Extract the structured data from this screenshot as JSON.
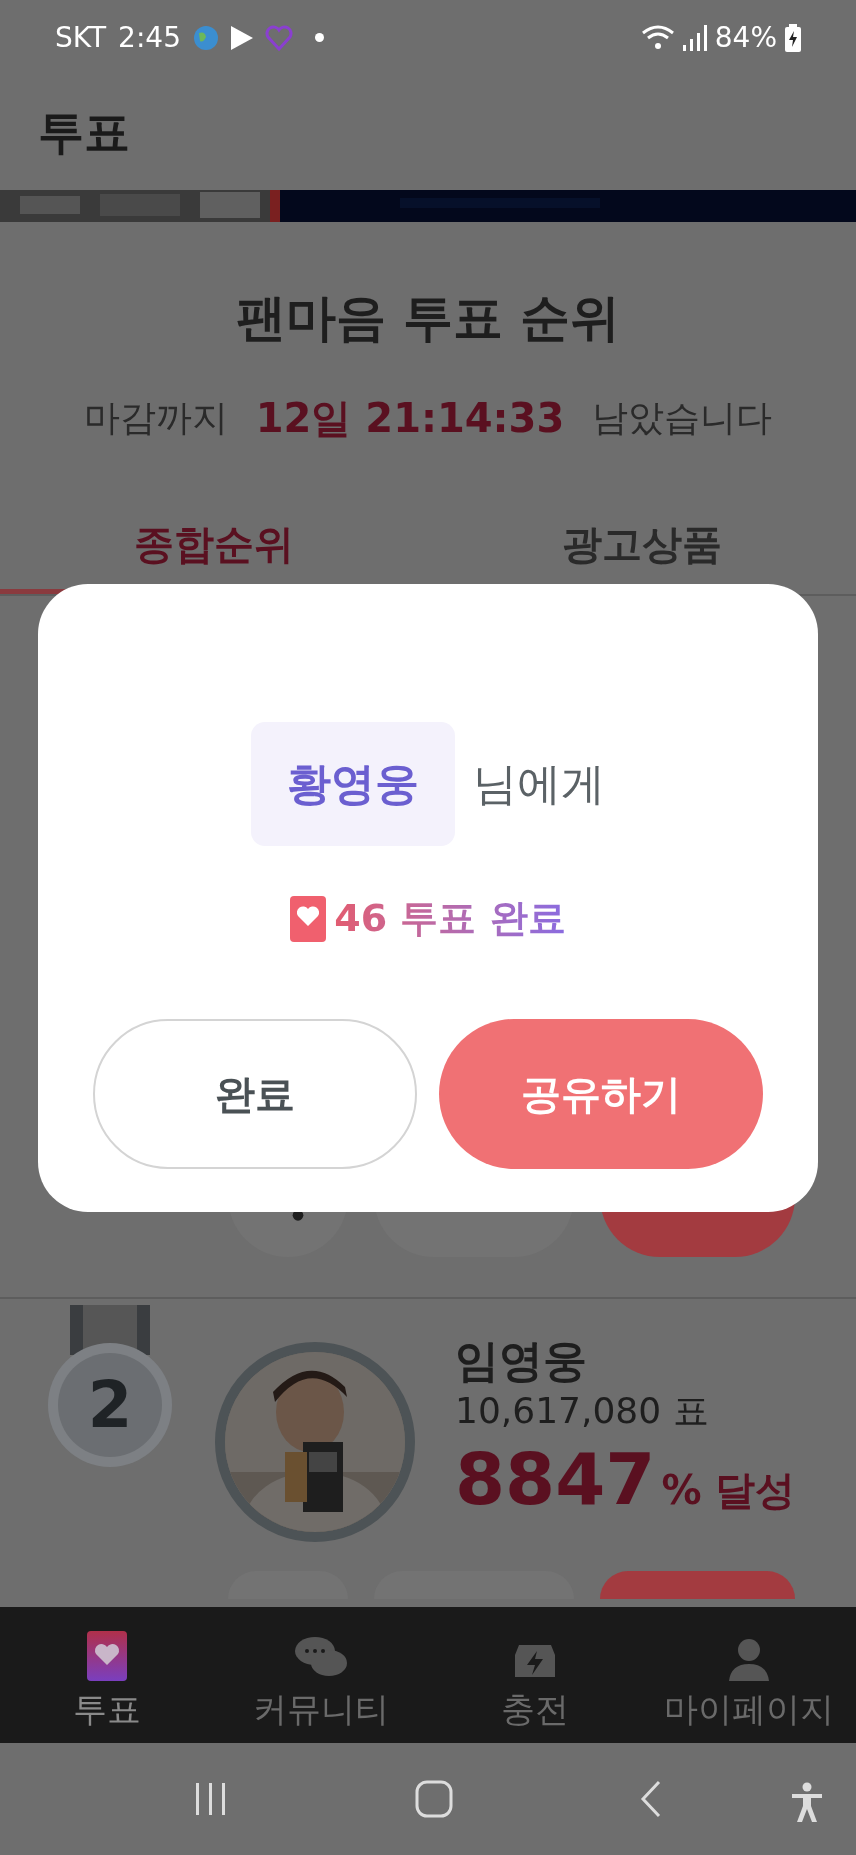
{
  "status_bar": {
    "carrier": "SKT",
    "time": "2:45",
    "battery": "84%"
  },
  "header": {
    "title": "투표"
  },
  "ranking": {
    "title": "팬마음 투표 순위",
    "countdown_prefix": "마감까지",
    "countdown": "12일 21:14:33",
    "countdown_suffix": "남았습니다"
  },
  "tabs": [
    {
      "label": "종합순위",
      "selected": true
    },
    {
      "label": "광고상품",
      "selected": false
    }
  ],
  "entries": [
    {
      "rank": "2",
      "name": "임영웅",
      "votes": "10,617,080 표",
      "percent": "8847",
      "percent_suffix": "% 달성"
    }
  ],
  "dialog": {
    "name": "황영웅",
    "suffix": "님에게",
    "result": "46 투표 완료",
    "buttons": [
      {
        "label": "완료",
        "kind": "secondary"
      },
      {
        "label": "공유하기",
        "kind": "primary"
      }
    ]
  },
  "bottom_nav": [
    {
      "label": "투표",
      "kind": "vote",
      "selected": true
    },
    {
      "label": "커뮤니티",
      "kind": "community",
      "selected": false
    },
    {
      "label": "충전",
      "kind": "charge",
      "selected": false
    },
    {
      "label": "마이페이지",
      "kind": "mypage",
      "selected": false
    }
  ]
}
